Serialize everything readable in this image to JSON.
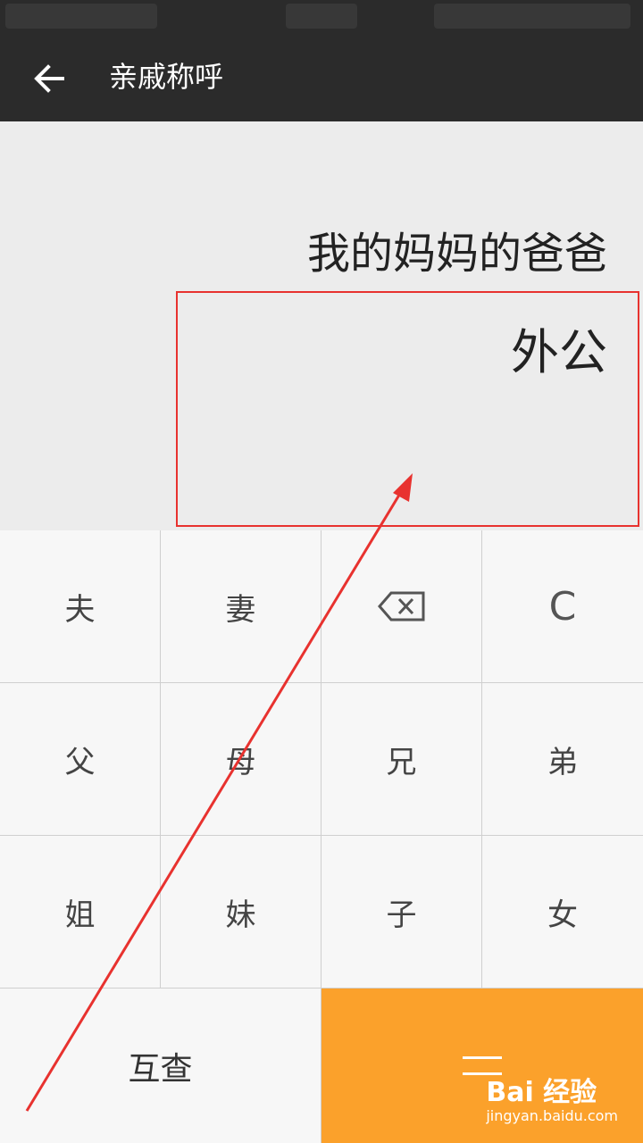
{
  "header": {
    "title": "亲戚称呼",
    "back_icon": "arrow-left-icon"
  },
  "display": {
    "expression": "我的妈妈的爸爸",
    "result": "外公"
  },
  "keypad": {
    "row1": [
      "夫",
      "妻",
      "",
      "C"
    ],
    "row2": [
      "父",
      "母",
      "兄",
      "弟"
    ],
    "row3": [
      "姐",
      "妹",
      "子",
      "女"
    ],
    "bottom": {
      "lookup": "互查",
      "equals_icon": "equals-icon"
    },
    "backspace_icon": "backspace-icon"
  },
  "colors": {
    "header_bg": "#2b2b2b",
    "accent": "#fba12b",
    "annotation": "#e8322f"
  },
  "watermark": {
    "brand": "Bai 经验",
    "url": "jingyan.baidu.com"
  }
}
